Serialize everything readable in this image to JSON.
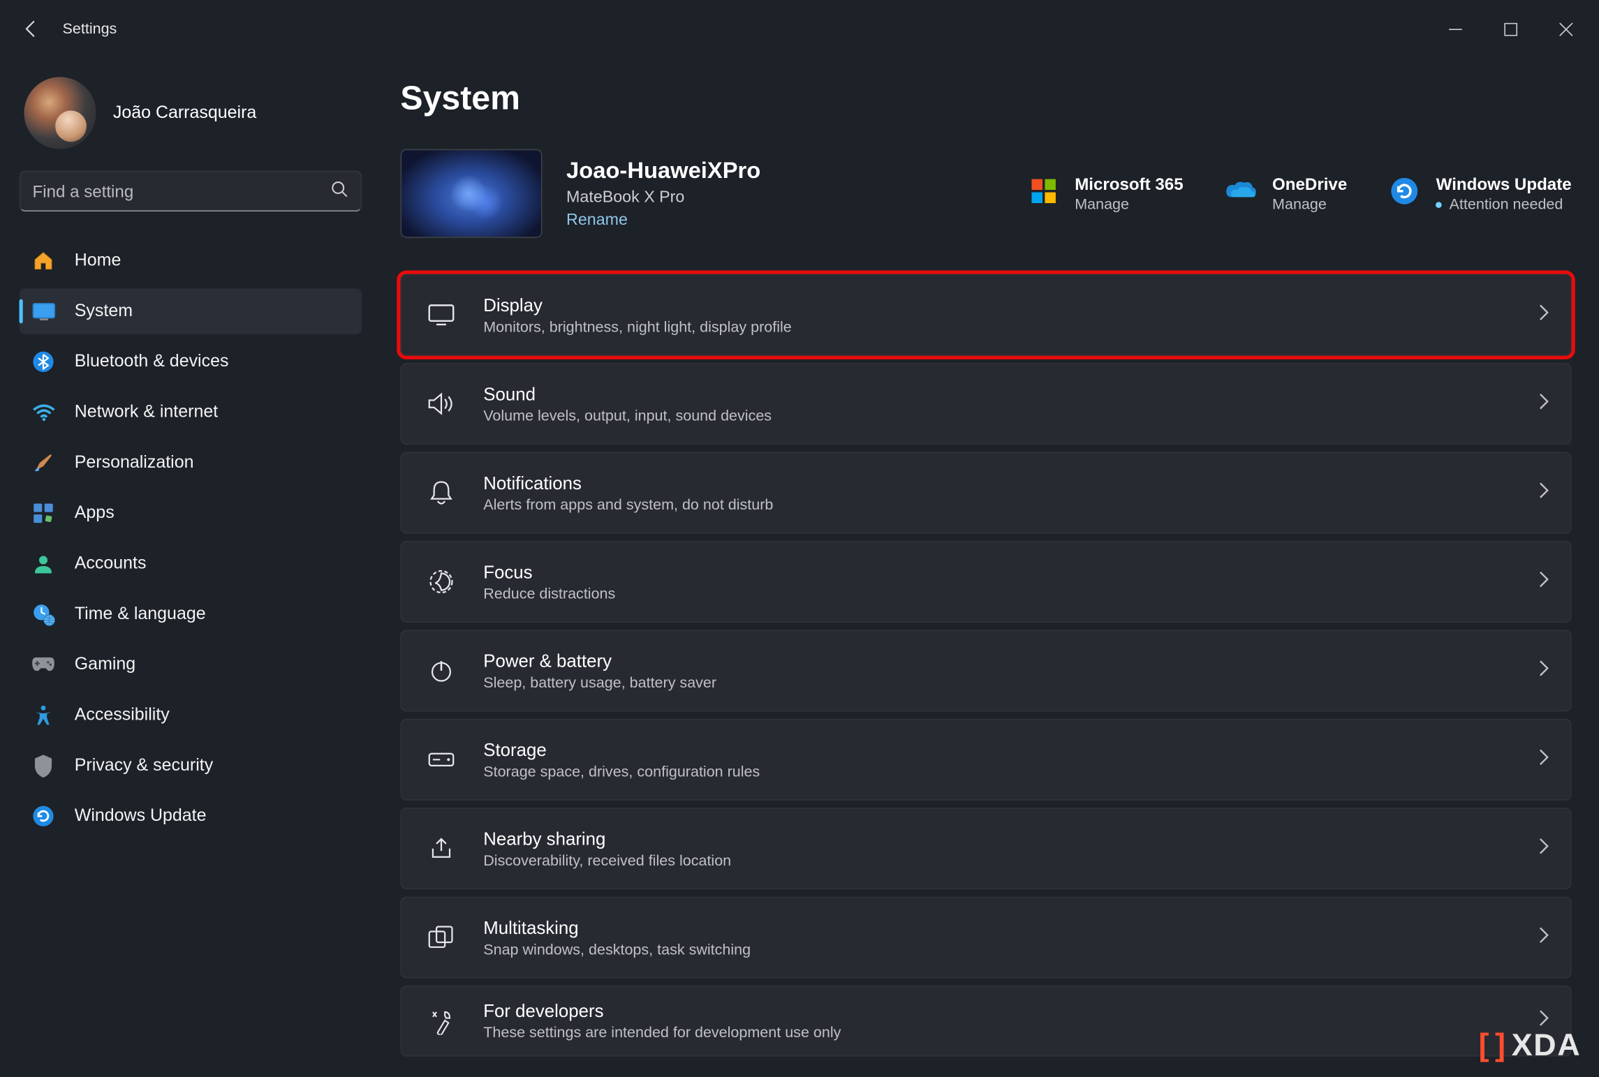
{
  "window": {
    "title": "Settings"
  },
  "user": {
    "name": "João Carrasqueira"
  },
  "search": {
    "placeholder": "Find a setting"
  },
  "nav": [
    {
      "label": "Home"
    },
    {
      "label": "System"
    },
    {
      "label": "Bluetooth & devices"
    },
    {
      "label": "Network & internet"
    },
    {
      "label": "Personalization"
    },
    {
      "label": "Apps"
    },
    {
      "label": "Accounts"
    },
    {
      "label": "Time & language"
    },
    {
      "label": "Gaming"
    },
    {
      "label": "Accessibility"
    },
    {
      "label": "Privacy & security"
    },
    {
      "label": "Windows Update"
    }
  ],
  "page": {
    "title": "System"
  },
  "device": {
    "name": "Joao-HuaweiXPro",
    "model": "MateBook X Pro",
    "rename": "Rename"
  },
  "quick": {
    "ms365": {
      "title": "Microsoft 365",
      "sub": "Manage"
    },
    "onedrive": {
      "title": "OneDrive",
      "sub": "Manage"
    },
    "update": {
      "title": "Windows Update",
      "sub": "Attention needed"
    }
  },
  "cards": [
    {
      "title": "Display",
      "sub": "Monitors, brightness, night light, display profile"
    },
    {
      "title": "Sound",
      "sub": "Volume levels, output, input, sound devices"
    },
    {
      "title": "Notifications",
      "sub": "Alerts from apps and system, do not disturb"
    },
    {
      "title": "Focus",
      "sub": "Reduce distractions"
    },
    {
      "title": "Power & battery",
      "sub": "Sleep, battery usage, battery saver"
    },
    {
      "title": "Storage",
      "sub": "Storage space, drives, configuration rules"
    },
    {
      "title": "Nearby sharing",
      "sub": "Discoverability, received files location"
    },
    {
      "title": "Multitasking",
      "sub": "Snap windows, desktops, task switching"
    },
    {
      "title": "For developers",
      "sub": "These settings are intended for development use only"
    }
  ],
  "watermark": "XDA"
}
